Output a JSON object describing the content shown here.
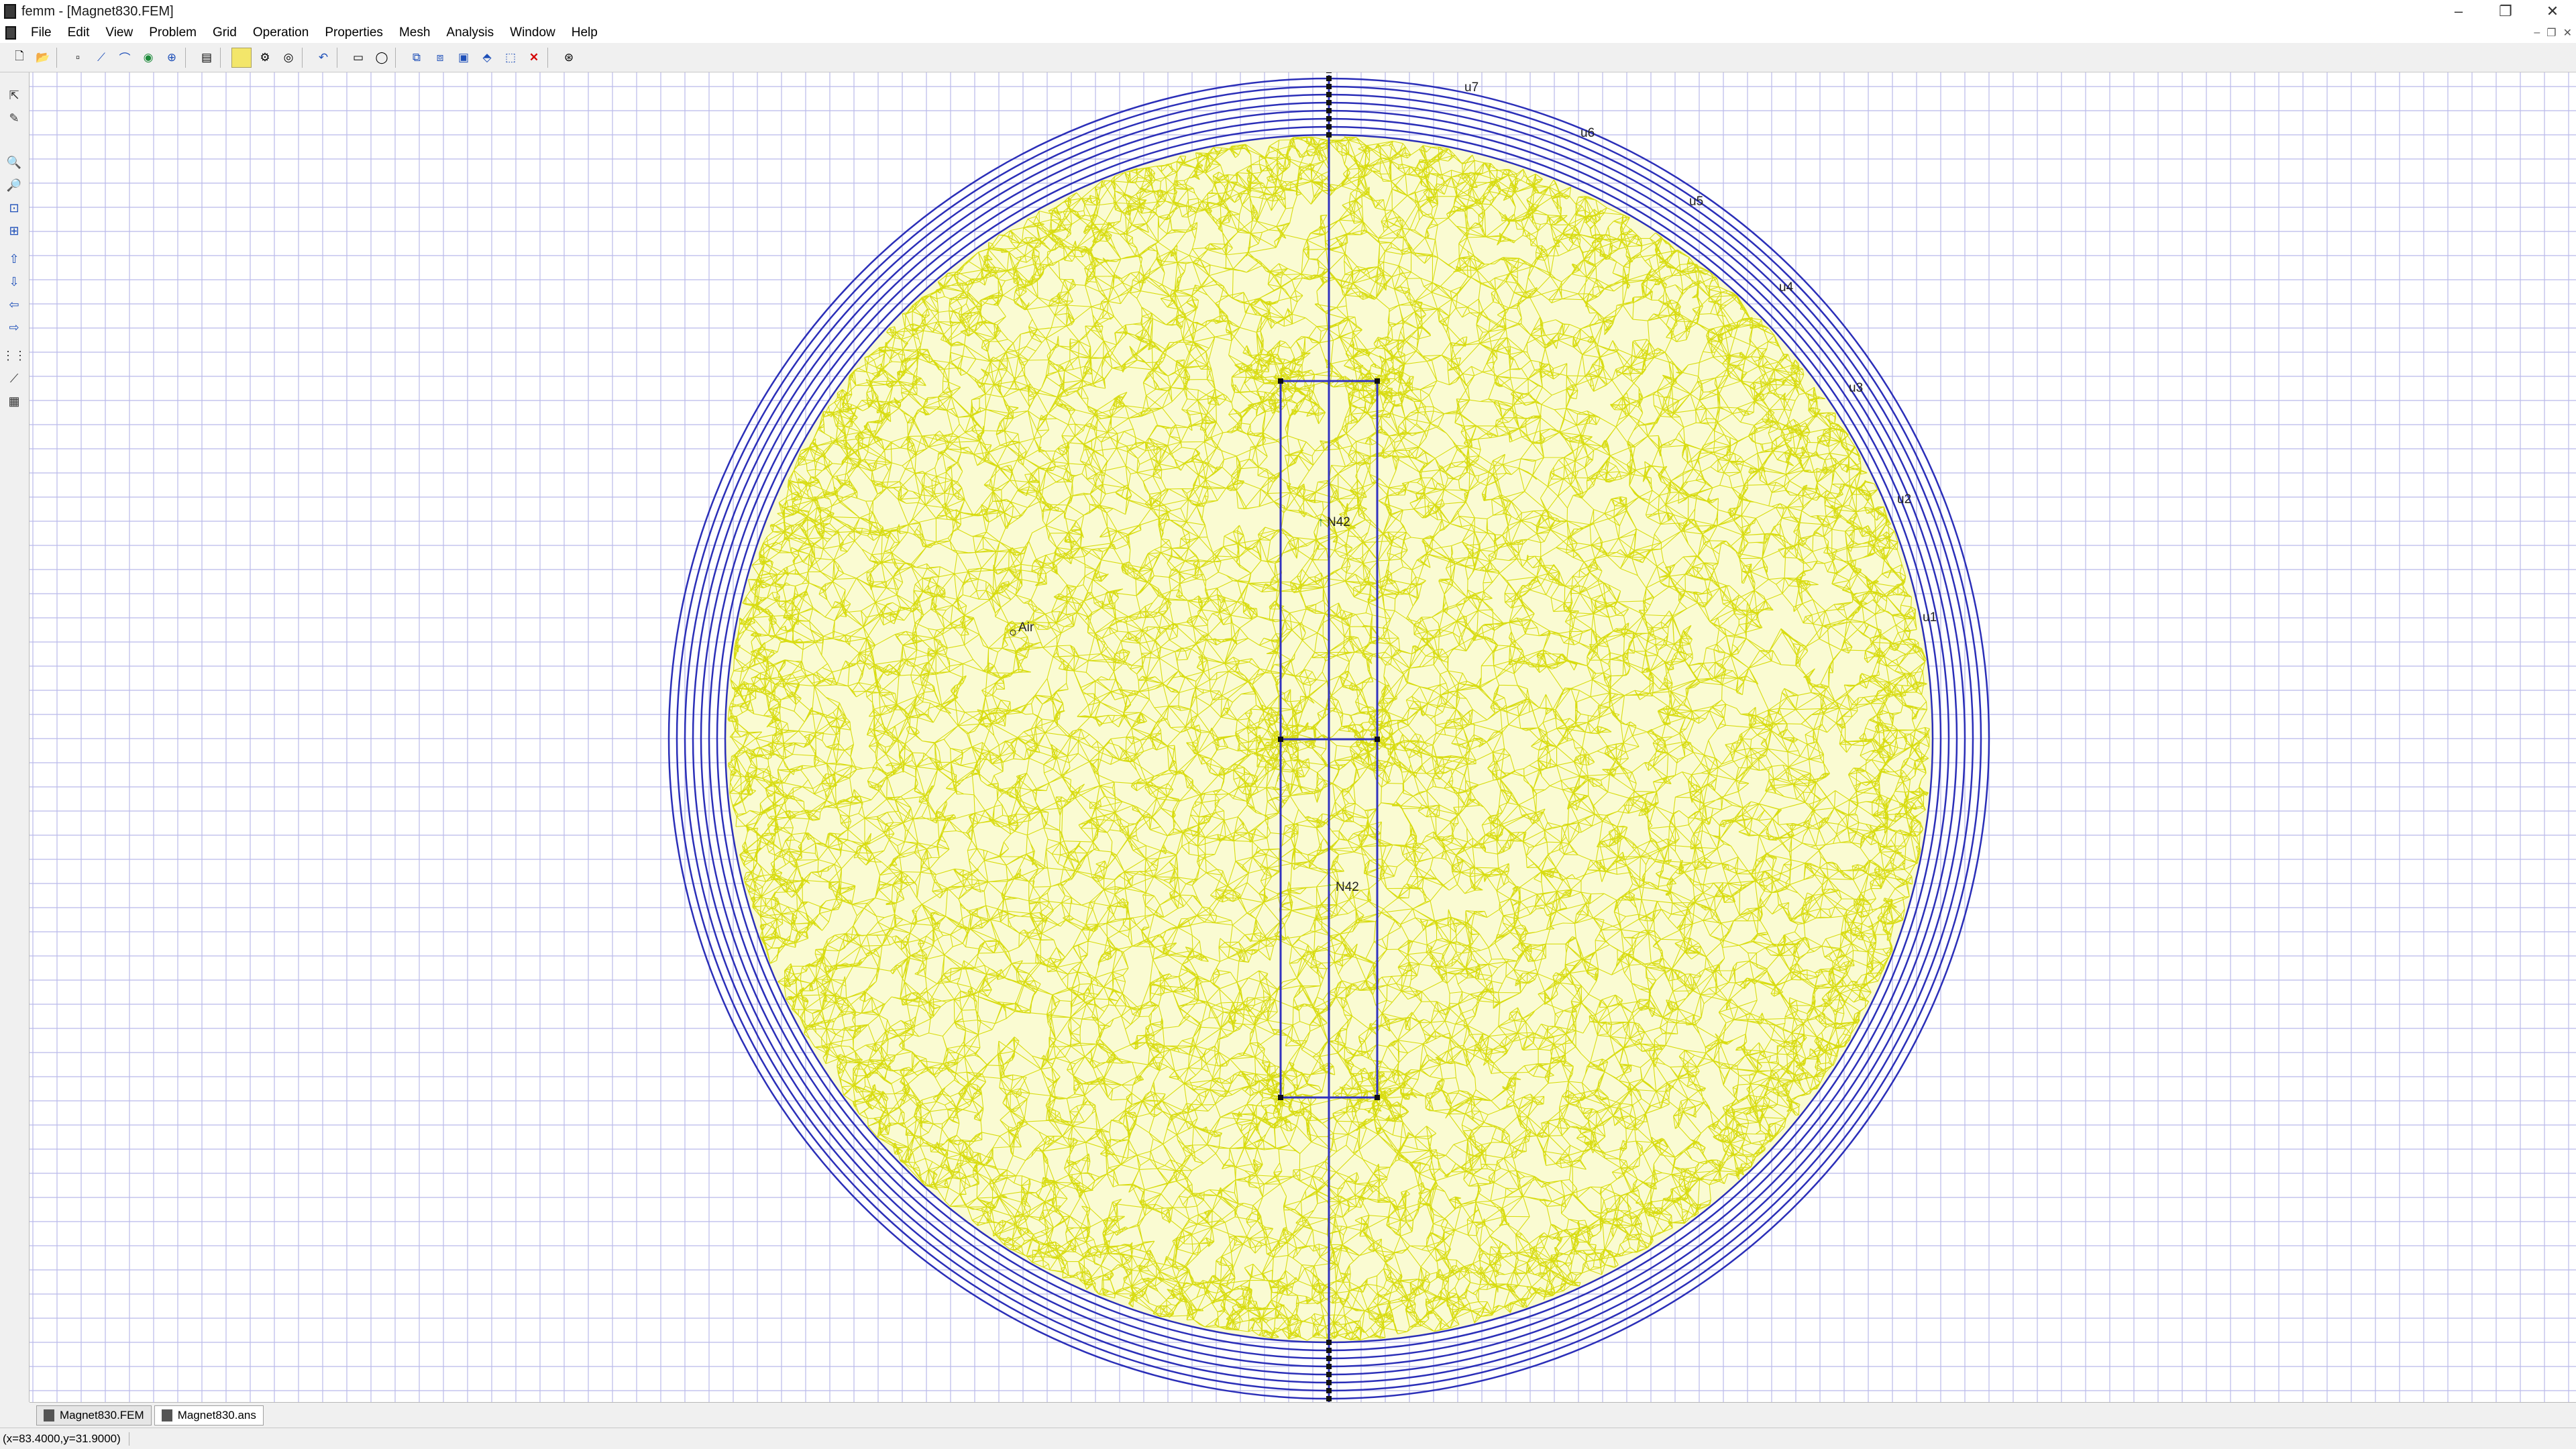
{
  "window": {
    "title": "femm - [Magnet830.FEM]",
    "controls": [
      "–",
      "❐",
      "✕"
    ]
  },
  "menu": {
    "items": [
      "File",
      "Edit",
      "View",
      "Problem",
      "Grid",
      "Operation",
      "Properties",
      "Mesh",
      "Analysis",
      "Window",
      "Help"
    ],
    "mdi_controls": [
      "–",
      "❐",
      "✕"
    ]
  },
  "canvas": {
    "colors": {
      "grid": "#b9b9ea",
      "boundary": "#2b2fb8",
      "mesh": "#d8dc10",
      "mesh_fill": "#fafbd2",
      "magnet": "#3232c0"
    },
    "labels": {
      "air": "Air",
      "magnet_top": "N42",
      "magnet_bottom": "N42",
      "u7": "u7",
      "u6": "u6",
      "u5": "u5",
      "u4": "u4",
      "u3": "u3",
      "u2": "u2",
      "u1": "u1"
    }
  },
  "tabs": [
    {
      "label": "Magnet830.FEM",
      "icon": "fem-doc-icon",
      "active": false
    },
    {
      "label": "Magnet830.ans",
      "icon": "ans-doc-icon",
      "active": true
    }
  ],
  "status": {
    "coordinates": "(x=83.4000,y=31.9000)"
  }
}
